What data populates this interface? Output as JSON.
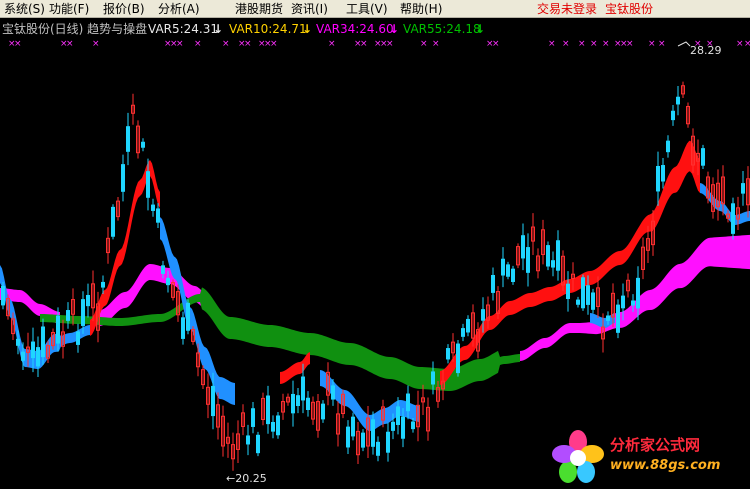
{
  "menu": {
    "items": [
      {
        "label": "系统(S)",
        "name": "menu-system"
      },
      {
        "label": "功能(F)",
        "name": "menu-function"
      },
      {
        "label": "报价(B)",
        "name": "menu-quote"
      },
      {
        "label": "分析(A)",
        "name": "menu-analysis"
      },
      {
        "label": "港股期货",
        "name": "menu-hk-futures"
      },
      {
        "label": "资讯(I)",
        "name": "menu-info"
      },
      {
        "label": "工具(V)",
        "name": "menu-tools"
      },
      {
        "label": "帮助(H)",
        "name": "menu-help"
      }
    ],
    "status_login": "交易未登录",
    "status_stock": "宝钛股份"
  },
  "indicator": {
    "title": "宝钛股份(日线) 趋势与操盘",
    "var5": "VAR5:24.31",
    "var10": "VAR10:24.71",
    "var34": "VAR34:24.60",
    "var55": "VAR55:24.18",
    "arrow": "↓",
    "colors": {
      "title": "#c0c0c0",
      "var5": "#e8e8e8",
      "var10": "#ffd200",
      "var34": "#ff00ff",
      "var55": "#00c000"
    }
  },
  "chart": {
    "high_label": "28.29",
    "low_label": "←20.25",
    "colors": {
      "up": "#ff3030",
      "down": "#1fd6ff",
      "band_red": "#ff1010",
      "band_blue": "#2090ff",
      "band_green": "#109010",
      "band_magenta": "#ff10ff",
      "marker": "#ff30ff"
    }
  },
  "watermark": {
    "text": "分析家公式网",
    "url": "www.88gs.com"
  }
}
